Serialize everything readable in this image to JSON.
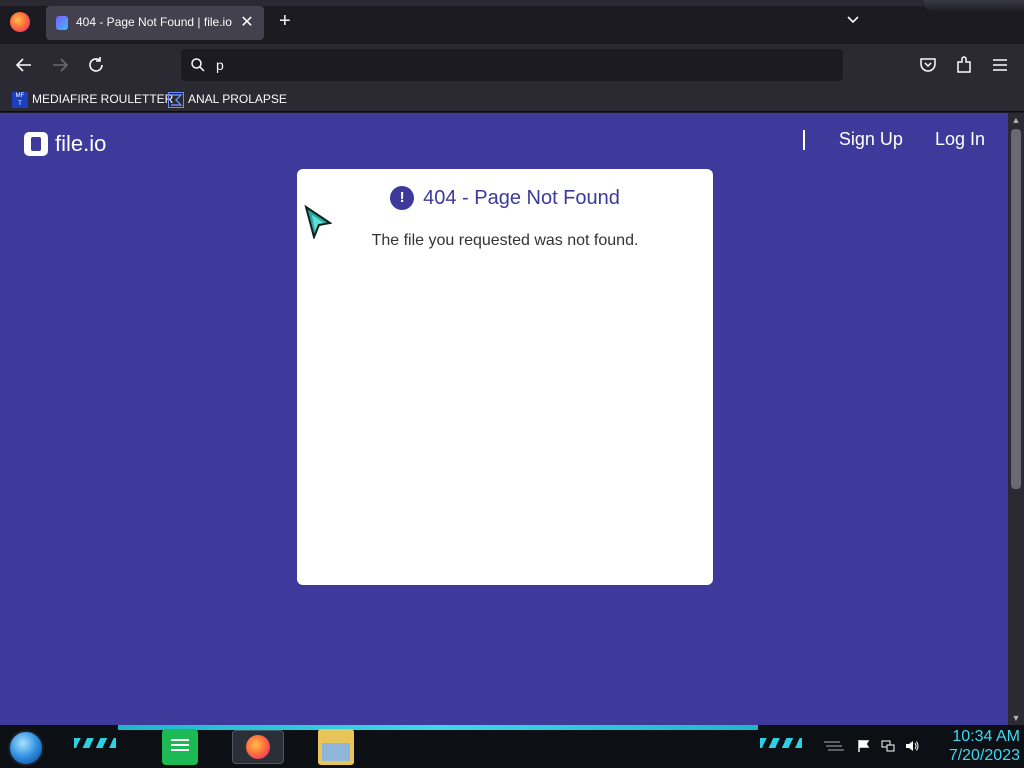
{
  "browser": {
    "tab": {
      "title": "404 - Page Not Found | file.io"
    },
    "url_value": "p",
    "bookmarks": [
      {
        "label": "MEDIAFIRE ROULETTER",
        "icon": "mediafire-icon",
        "icon_text": "MF\nT"
      },
      {
        "label": "ANAL PROLAPSE",
        "icon": "sigma-icon"
      }
    ]
  },
  "site": {
    "logo_text": "file.io",
    "nav": {
      "sign_up": "Sign Up",
      "log_in": "Log In"
    },
    "card": {
      "title": "404 - Page Not Found",
      "message": "The file you requested was not found.",
      "icon": "!"
    }
  },
  "taskbar": {
    "apps": [
      "notes-icon",
      "firefox-icon",
      "file-explorer-icon"
    ],
    "clock": {
      "time": "10:34 AM",
      "date": "7/20/2023"
    }
  },
  "colors": {
    "page_bg": "#3d3a9c",
    "card_title": "#3d3a9c",
    "clock": "#3fd8f0"
  }
}
